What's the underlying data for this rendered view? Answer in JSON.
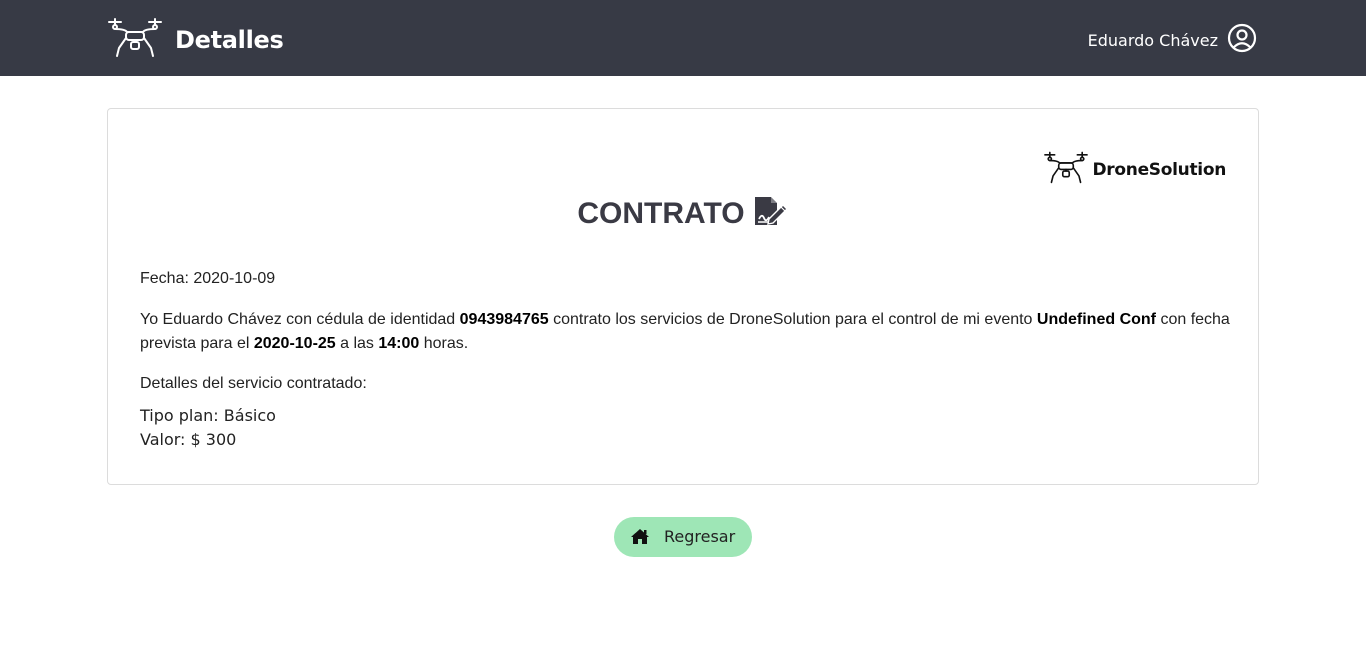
{
  "navbar": {
    "title": "Detalles",
    "logo_icon": "drone-icon",
    "user_name": "Eduardo Chávez",
    "user_icon": "user-circle-icon"
  },
  "contract": {
    "brand_name": "DroneSolution",
    "heading": "CONTRATO",
    "heading_icon": "file-signature-icon",
    "fecha_label": "Fecha: ",
    "fecha_value": "2020-10-09",
    "text_1": "Yo Eduardo Chávez con cédula de identidad ",
    "cedula": "0943984765",
    "text_2": " contrato los servicios de DroneSolution para el control de mi evento ",
    "evento": "Undefined Conf",
    "text_3": " con fecha prevista para el ",
    "fecha_evento": "2020-10-25",
    "text_4": " a las ",
    "hora": "14:00",
    "text_5": " horas.",
    "detalles_label": "Detalles del servicio contratado:",
    "plan_line": "Tipo plan: Básico",
    "valor_line": "Valor: $ 300"
  },
  "actions": {
    "back_label": "Regresar",
    "back_icon": "home-icon",
    "back_color": "#9ee6b6"
  },
  "colors": {
    "navbar_bg": "#373a45",
    "navbar_text": "#ffffff"
  }
}
